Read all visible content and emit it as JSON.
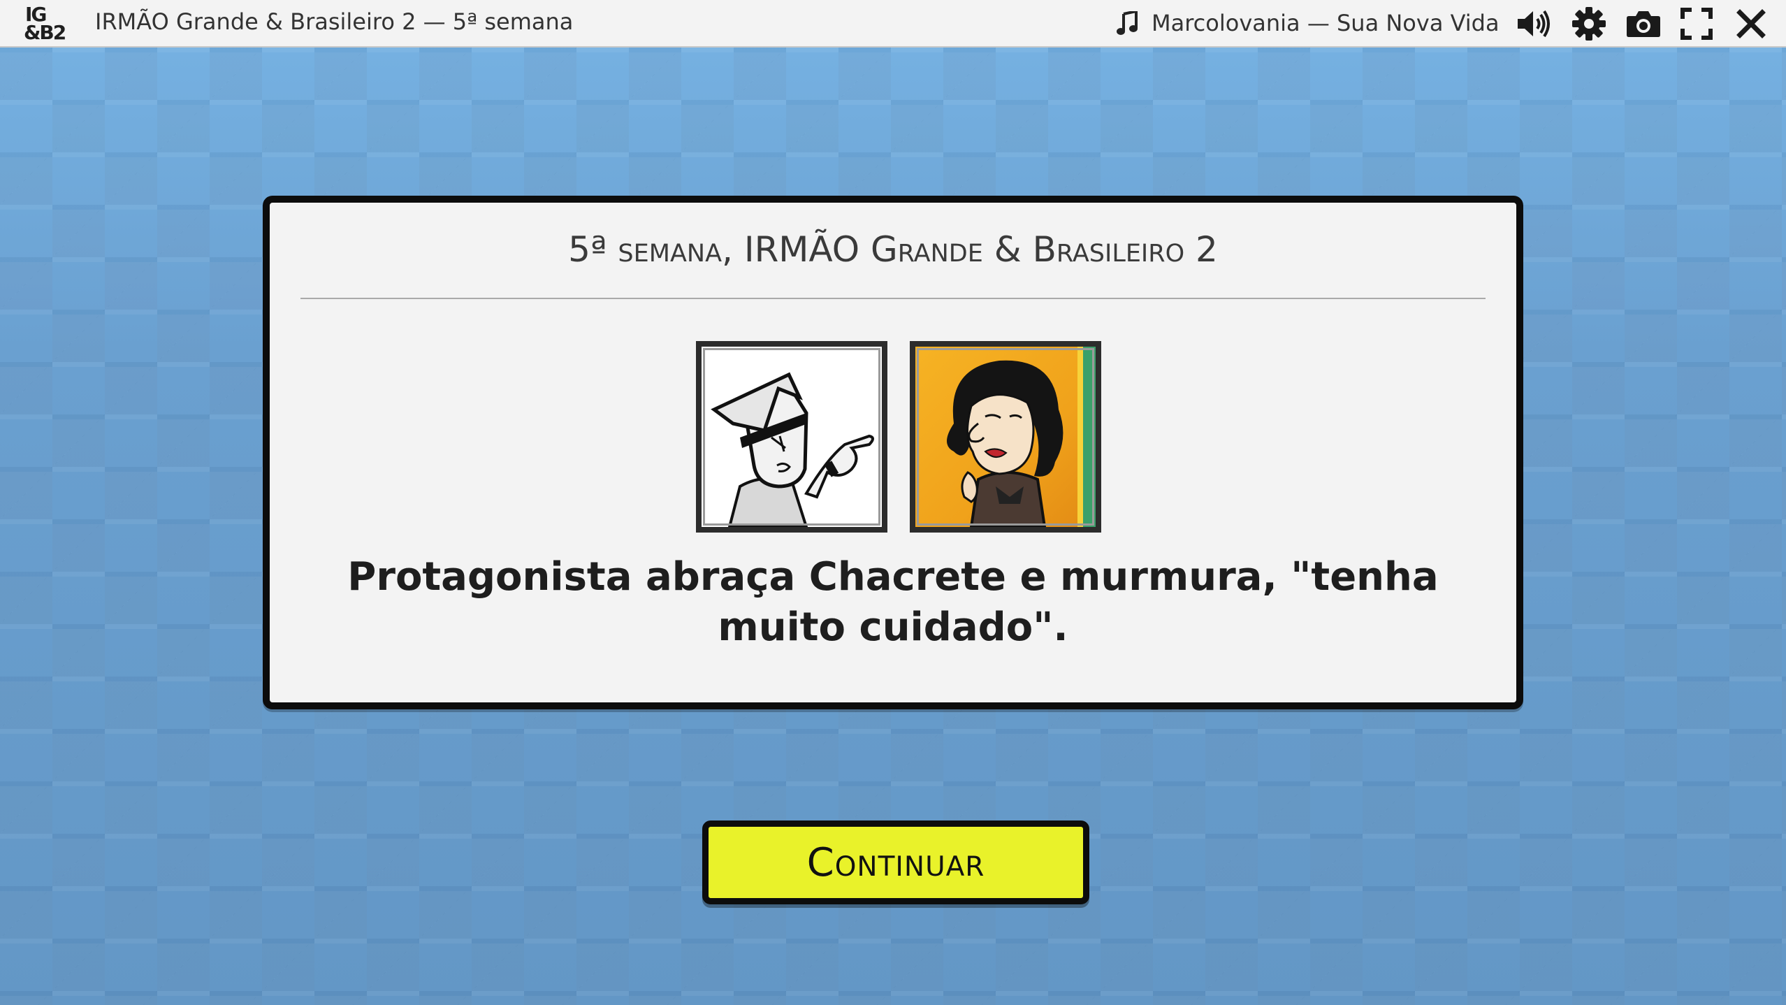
{
  "topbar": {
    "logo_line1": "IG",
    "logo_line2": "&B2",
    "app_title": "IRMÃO Grande & Brasileiro 2 — 5ª semana",
    "music_icon": "music-note-icon",
    "music_title": "Marcolovania — Sua Nova Vida",
    "icons": [
      "volume-icon",
      "gear-icon",
      "camera-icon",
      "fullscreen-icon",
      "close-icon"
    ]
  },
  "card": {
    "title": "5ª semana, IRMÃO Grande & Brasileiro 2",
    "message": "Protagonista abraça Chacrete e murmura, \"tenha muito cuidado\".",
    "portraits": [
      {
        "name": "protagonista-portrait",
        "background": "#ffffff"
      },
      {
        "name": "chacrete-portrait",
        "background": "#f2a020"
      }
    ]
  },
  "continue_button": {
    "label": "Continuar",
    "color": "#e9f22a"
  },
  "colors": {
    "background": "#6fa3d3",
    "topbar": "#f3f3f3",
    "card": "#f3f3f3",
    "border": "#0c0c0c"
  }
}
